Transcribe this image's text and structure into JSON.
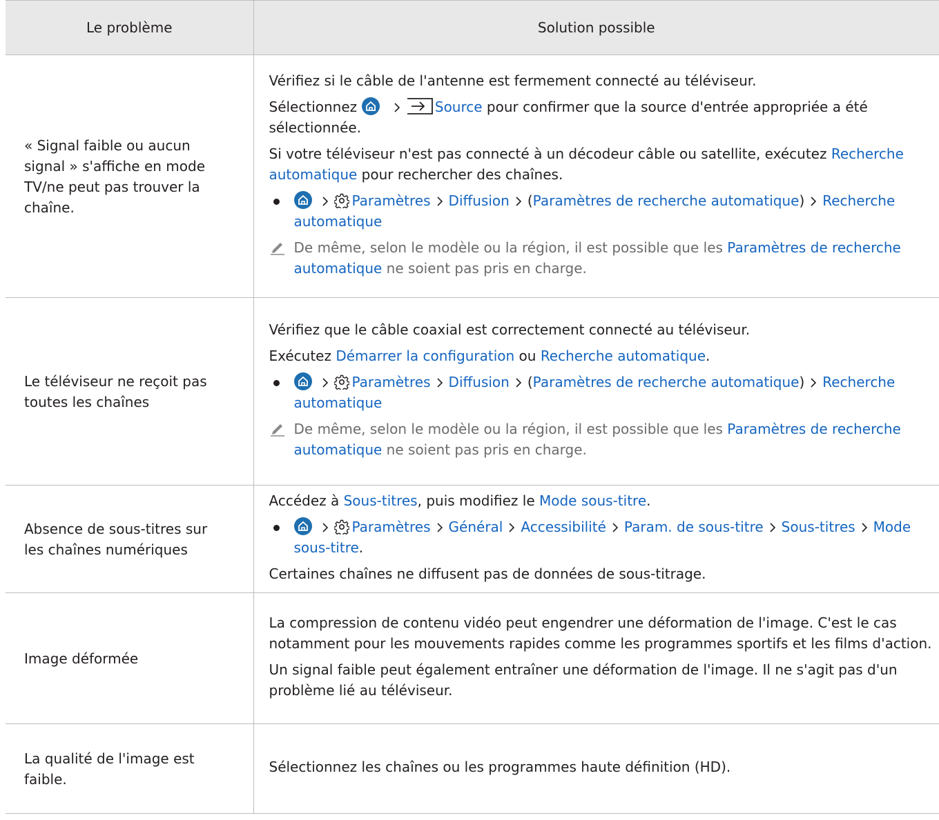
{
  "table": {
    "headers": [
      "Le problème",
      "Solution possible"
    ],
    "rows": [
      {
        "problem": "« Signal faible ou aucun signal » s'affiche en mode TV/ne peut pas trouver la chaîne.",
        "p1": "Vérifiez si le câble de l'antenne est fermement connecté au téléviseur.",
        "p2_a": "Sélectionnez",
        "p2_link": "Source",
        "p2_b": " pour confirmer que la source d'entrée appropriée a été sélectionnée.",
        "p3_a": "Si votre téléviseur n'est pas connecté à un décodeur câble ou satellite, exécutez ",
        "p3_link": "Recherche automatique",
        "p3_b": " pour rechercher des chaînes.",
        "path": [
          "Paramètres",
          "Diffusion",
          "Paramètres de recherche automatique",
          "Recherche automatique"
        ],
        "note_a": "De même, selon le modèle ou la région, il est possible que les ",
        "note_link": "Paramètres de recherche automatique",
        "note_b": " ne soient pas pris en charge."
      },
      {
        "problem": "Le téléviseur ne reçoit pas toutes les chaînes",
        "p1": "Vérifiez que le câble coaxial est correctement connecté au téléviseur.",
        "p2_a": "Exécutez ",
        "p2_link1": "Démarrer la configuration",
        "p2_mid": " ou ",
        "p2_link2": "Recherche automatique",
        "p2_end": ".",
        "path": [
          "Paramètres",
          "Diffusion",
          "Paramètres de recherche automatique",
          "Recherche automatique"
        ],
        "note_a": "De même, selon le modèle ou la région, il est possible que les ",
        "note_link": "Paramètres de recherche automatique",
        "note_b": " ne soient pas pris en charge."
      },
      {
        "problem": "Absence de sous-titres sur les chaînes numériques",
        "p1_a": "Accédez à ",
        "p1_link1": "Sous-titres",
        "p1_mid": ", puis modifiez le ",
        "p1_link2": "Mode sous-titre",
        "p1_end": ".",
        "path": [
          "Paramètres",
          "Général",
          "Accessibilité",
          "Param. de sous-titre",
          "Sous-titres",
          "Mode sous-titre"
        ],
        "p2": "Certaines chaînes ne diffusent pas de données de sous-titrage."
      },
      {
        "problem": "Image déformée",
        "p1": "La compression de contenu vidéo peut engendrer une déformation de l'image. C'est le cas notamment pour les mouvements rapides comme les programmes sportifs et les films d'action.",
        "p2": "Un signal faible peut également entraîner une déformation de l'image. Il ne s'agit pas d'un problème lié au téléviseur."
      },
      {
        "problem": "La qualité de l'image est faible.",
        "p1": "Sélectionnez les chaînes ou les programmes haute définition (HD)."
      }
    ]
  },
  "icons": {
    "home": "home-icon",
    "settings": "gear-icon",
    "source": "source-icon",
    "note": "pencil-note-icon",
    "separator": "chevron-right-icon"
  },
  "colors": {
    "link": "#1565c0",
    "note_text": "#6b6b6b",
    "header_bg": "#e8e8e8",
    "home_circle": "#1e6fb0"
  }
}
